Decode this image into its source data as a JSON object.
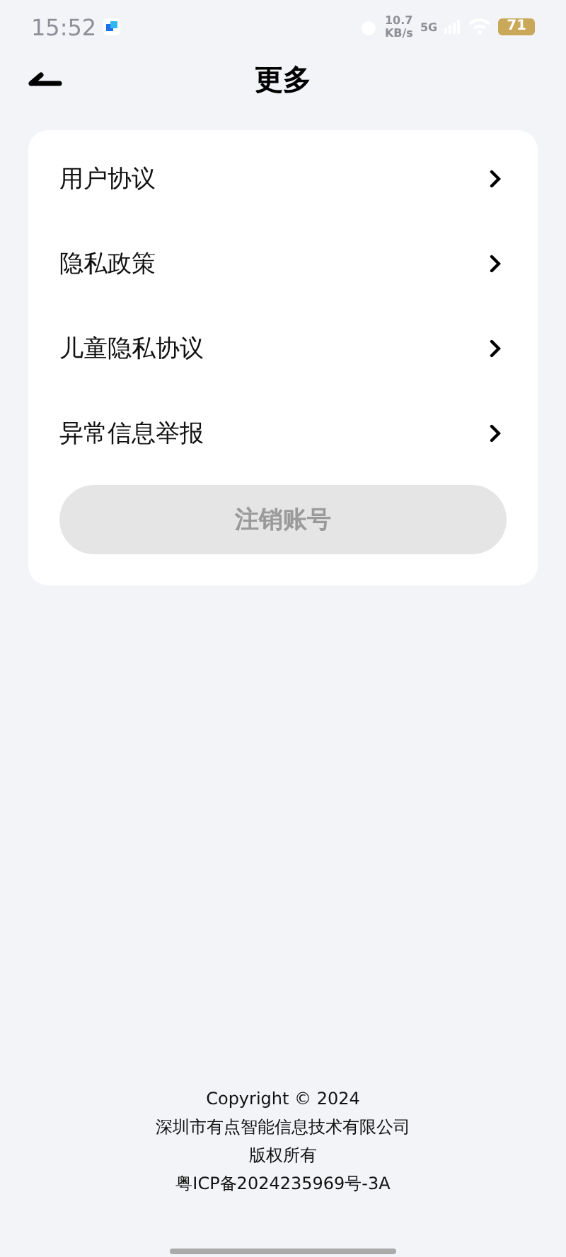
{
  "status_bar": {
    "time": "15:52",
    "net_speed": "10.7",
    "net_unit": "KB/s",
    "network": "5G",
    "battery": "71"
  },
  "header": {
    "title": "更多"
  },
  "menu": [
    {
      "label": "用户协议"
    },
    {
      "label": "隐私政策"
    },
    {
      "label": "儿童隐私协议"
    },
    {
      "label": "异常信息举报"
    }
  ],
  "cancel_button": {
    "label": "注销账号",
    "disabled": true
  },
  "footer": [
    "Copyright © 2024",
    "深圳市有点智能信息技术有限公司",
    "版权所有",
    "粤ICP备2024235969号-3A"
  ]
}
